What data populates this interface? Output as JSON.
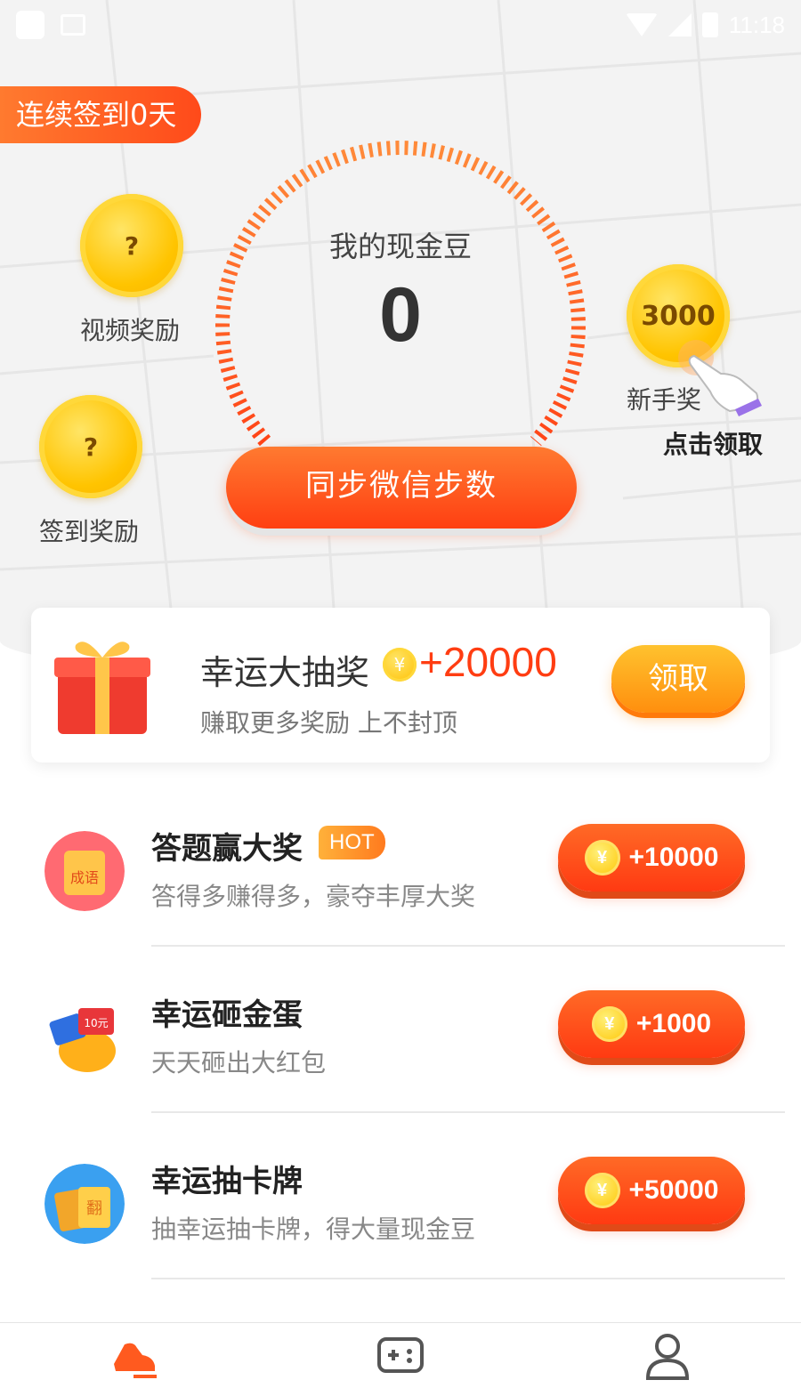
{
  "status_bar": {
    "time": "11:18"
  },
  "hero": {
    "streak_label": "连续签到0天",
    "balance_title": "我的现金豆",
    "balance_value": "0",
    "sync_button": "同步微信步数"
  },
  "bubbles": [
    {
      "id": "video",
      "coin_text": "?",
      "label": "视频奖励"
    },
    {
      "id": "checkin",
      "coin_text": "?",
      "label": "签到奖励"
    },
    {
      "id": "newbie",
      "coin_text": "3000",
      "label": "新手奖",
      "tip": "点击领取"
    }
  ],
  "lottery": {
    "title": "幸运大抽奖",
    "coin_symbol": "¥",
    "amount": "+20000",
    "subtitle": "赚取更多奖励 上不封顶",
    "claim_label": "领取"
  },
  "tasks": [
    {
      "title": "答题赢大奖",
      "badge": "HOT",
      "subtitle": "答得多赚得多，豪夺丰厚大奖",
      "reward": "+10000",
      "icon": "idiom-quiz-icon",
      "icon_text": "成语"
    },
    {
      "title": "幸运砸金蛋",
      "subtitle": "天天砸出大红包",
      "reward": "+1000",
      "icon": "golden-egg-icon",
      "icon_text": "10元"
    },
    {
      "title": "幸运抽卡牌",
      "subtitle": "抽幸运抽卡牌，得大量现金豆",
      "reward": "+50000",
      "icon": "card-flip-icon",
      "icon_text": "翻"
    }
  ],
  "tabbar": [
    {
      "id": "steps",
      "icon": "running-shoe-icon",
      "active": true
    },
    {
      "id": "games",
      "icon": "gamepad-icon",
      "active": false
    },
    {
      "id": "profile",
      "icon": "user-icon",
      "active": false
    }
  ],
  "colors": {
    "accent": "#ff4a1a",
    "gold": "#ffc400",
    "claim": "#ff9a14"
  }
}
